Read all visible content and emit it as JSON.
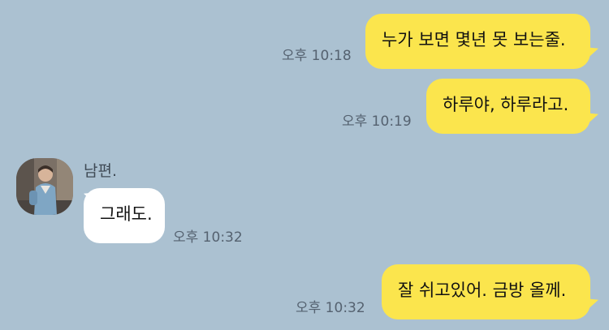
{
  "messages": [
    {
      "direction": "out",
      "text": "누가 보면 몇년 못 보는줄.",
      "time": "오후 10:18"
    },
    {
      "direction": "out",
      "text": "하루야, 하루라고.",
      "time": "오후 10:19"
    },
    {
      "direction": "in",
      "sender": "남편.",
      "text": "그래도.",
      "time": "오후 10:32"
    },
    {
      "direction": "out",
      "text": "잘 쉬고있어. 금방 올께.",
      "time": "오후 10:32"
    }
  ],
  "colors": {
    "background": "#abc1d1",
    "outgoing_bubble": "#fbe54d",
    "incoming_bubble": "#ffffff",
    "timestamp": "#556270"
  }
}
